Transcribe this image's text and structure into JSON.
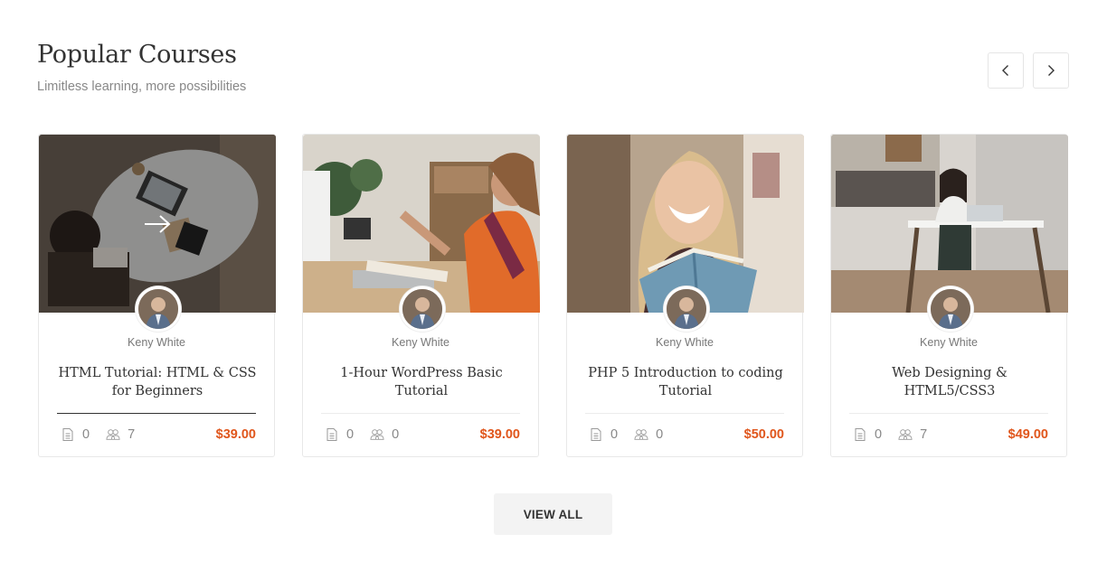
{
  "header": {
    "title": "Popular Courses",
    "subtitle": "Limitless learning, more possibilities"
  },
  "nav": {
    "prev_icon": "chevron-left-icon",
    "next_icon": "chevron-right-icon"
  },
  "colors": {
    "price": "#e0561c",
    "border": "#e8e8e8",
    "button_bg": "#f3f3f3"
  },
  "courses": [
    {
      "instructor": "Keny White",
      "title": "HTML Tutorial: HTML & CSS for Beginners",
      "lessons": "0",
      "students": "7",
      "price": "$39.00",
      "image": "desk-laptop-overhead-photo"
    },
    {
      "instructor": "Keny White",
      "title": "1-Hour WordPress Basic Tutorial",
      "lessons": "0",
      "students": "0",
      "price": "$39.00",
      "image": "student-writing-at-desk-photo"
    },
    {
      "instructor": "Keny White",
      "title": "PHP 5 Introduction to coding Tutorial",
      "lessons": "0",
      "students": "0",
      "price": "$50.00",
      "image": "smiling-girl-with-book-photo"
    },
    {
      "instructor": "Keny White",
      "title": "Web Designing & HTML5/CSS3",
      "lessons": "0",
      "students": "7",
      "price": "$49.00",
      "image": "woman-at-kitchen-table-laptop-photo"
    }
  ],
  "view_all": "VIEW ALL"
}
